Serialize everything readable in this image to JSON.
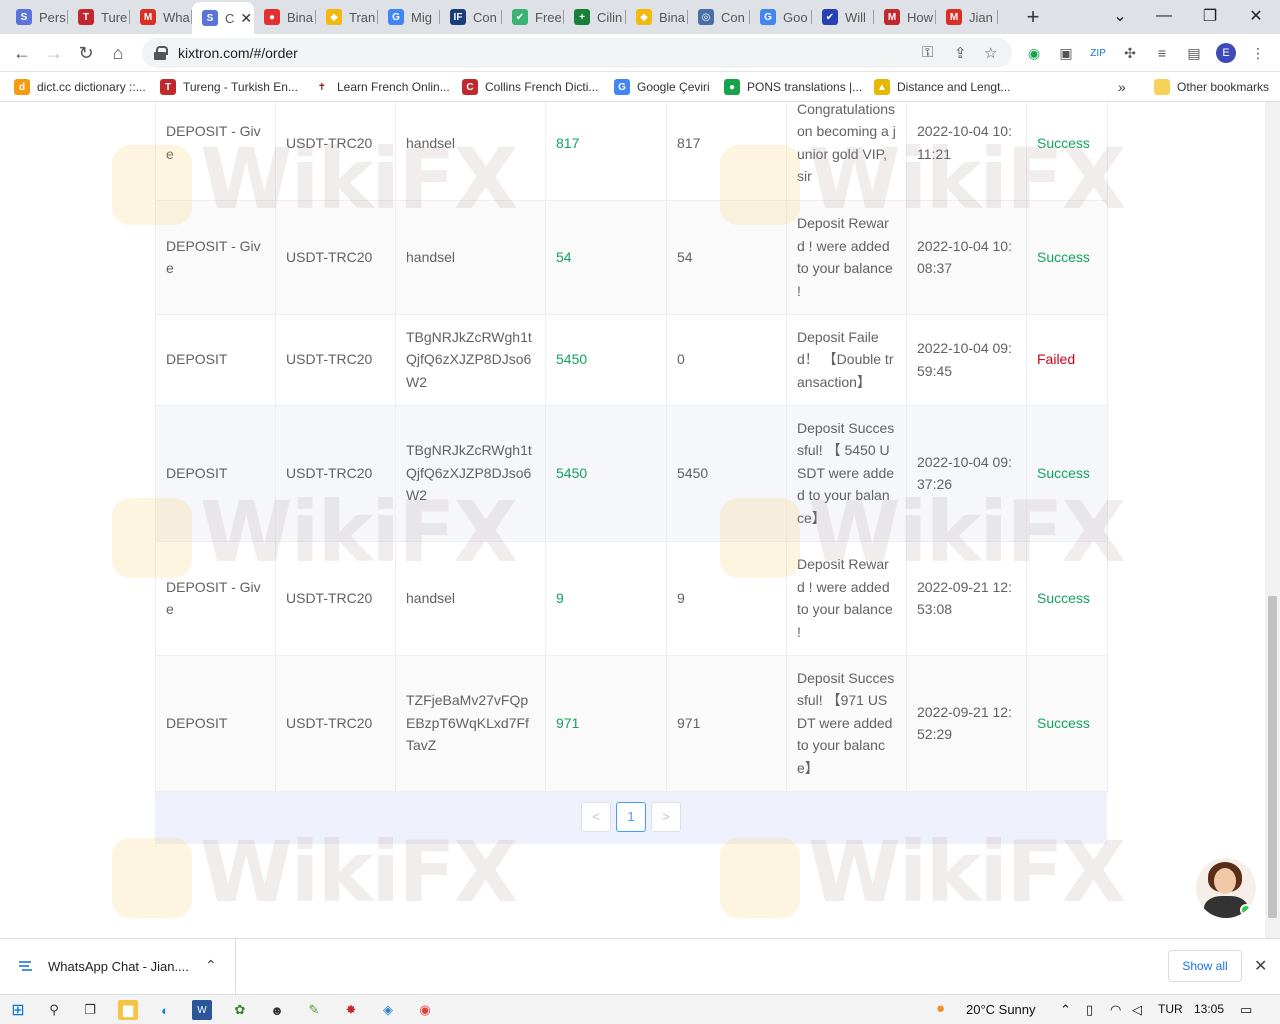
{
  "tabs": [
    {
      "label": "Pers",
      "fav": "#5a74d9",
      "glyph": "S"
    },
    {
      "label": "Ture",
      "fav": "#c0282d",
      "glyph": "T"
    },
    {
      "label": "Wha",
      "fav": "#d93025",
      "glyph": "M"
    },
    {
      "label": "C",
      "fav": "#5a74d9",
      "glyph": "S",
      "active": true
    },
    {
      "label": "Bina",
      "fav": "#e03030",
      "glyph": "●"
    },
    {
      "label": "Tran",
      "fav": "#f0b90b",
      "glyph": "◆"
    },
    {
      "label": "Mig",
      "fav": "#4285f4",
      "glyph": "G"
    },
    {
      "label": "Con",
      "fav": "#1a3d7c",
      "glyph": "IF"
    },
    {
      "label": "Free",
      "fav": "#3bb273",
      "glyph": "✔"
    },
    {
      "label": "Cilin",
      "fav": "#188038",
      "glyph": "+"
    },
    {
      "label": "Bina",
      "fav": "#f0b90b",
      "glyph": "◆"
    },
    {
      "label": "Con",
      "fav": "#4a6fa5",
      "glyph": "◎"
    },
    {
      "label": "Goo",
      "fav": "#4285f4",
      "glyph": "G"
    },
    {
      "label": "Will",
      "fav": "#2541b2",
      "glyph": "✔"
    },
    {
      "label": "How",
      "fav": "#c0282d",
      "glyph": "M"
    },
    {
      "label": "Jian",
      "fav": "#d93025",
      "glyph": "M"
    }
  ],
  "address": {
    "url": "kixtron.com/#/order"
  },
  "bookmarks": [
    {
      "label": "dict.cc dictionary ::...",
      "fav": "#f39c12",
      "glyph": "d"
    },
    {
      "label": "Tureng - Turkish En...",
      "fav": "#c0282d",
      "glyph": "T"
    },
    {
      "label": "Learn French Onlin...",
      "fav": "#ffffff",
      "glyph": "✝"
    },
    {
      "label": "Collins French Dicti...",
      "fav": "#c0282d",
      "glyph": "C"
    },
    {
      "label": "Google Çeviri",
      "fav": "#4285f4",
      "glyph": "G"
    },
    {
      "label": "PONS translations |...",
      "fav": "#16a34a",
      "glyph": "●"
    },
    {
      "label": "Distance and Lengt...",
      "fav": "#e6b800",
      "glyph": "▲"
    }
  ],
  "other_bookmarks": "Other bookmarks",
  "rows": [
    {
      "type": "DEPOSIT - Give",
      "currency": "USDT-TRC20",
      "address": "handsel",
      "amount": "817",
      "received": "817",
      "remark": "Congratulations on becoming a junior gold VIP, sir",
      "time": "2022-10-04 10:11:21",
      "status": "Success"
    },
    {
      "type": "DEPOSIT - Give",
      "currency": "USDT-TRC20",
      "address": "handsel",
      "amount": "54",
      "received": "54",
      "remark": "Deposit Reward ! were added to your balance !",
      "time": "2022-10-04 10:08:37",
      "status": "Success"
    },
    {
      "type": "DEPOSIT",
      "currency": "USDT-TRC20",
      "address": "TBgNRJkZcRWgh1tQjfQ6zXJZP8DJso6W2",
      "amount": "5450",
      "received": "0",
      "remark": "Deposit Failed！ 【Double transaction】",
      "time": "2022-10-04 09:59:45",
      "status": "Failed"
    },
    {
      "type": "DEPOSIT",
      "currency": "USDT-TRC20",
      "address": "TBgNRJkZcRWgh1tQjfQ6zXJZP8DJso6W2",
      "amount": "5450",
      "received": "5450",
      "remark": "Deposit Successful! 【 5450 USDT were added to your balance】",
      "time": "2022-10-04 09:37:26",
      "status": "Success"
    },
    {
      "type": "DEPOSIT - Give",
      "currency": "USDT-TRC20",
      "address": "handsel",
      "amount": "9",
      "received": "9",
      "remark": "Deposit Reward ! were added to your balance !",
      "time": "2022-09-21 12:53:08",
      "status": "Success"
    },
    {
      "type": "DEPOSIT",
      "currency": "USDT-TRC20",
      "address": "TZFjeBaMv27vFQpEBzpT6WqKLxd7FfTavZ",
      "amount": "971",
      "received": "971",
      "remark": "Deposit Successful! 【971 USDT were added to your balance】",
      "time": "2022-09-21 12:52:29",
      "status": "Success"
    }
  ],
  "pagination": {
    "prev": "<",
    "current": "1",
    "next": ">"
  },
  "watermark": "WikiFX",
  "download": {
    "name": "WhatsApp Chat - Jian....",
    "show_all": "Show all"
  },
  "taskbar": {
    "weather": "20°C  Sunny",
    "lang": "TUR",
    "time": "13:05"
  },
  "colors": {
    "success": "#13a35b",
    "failed": "#d0021b",
    "accent": "#409eff"
  }
}
